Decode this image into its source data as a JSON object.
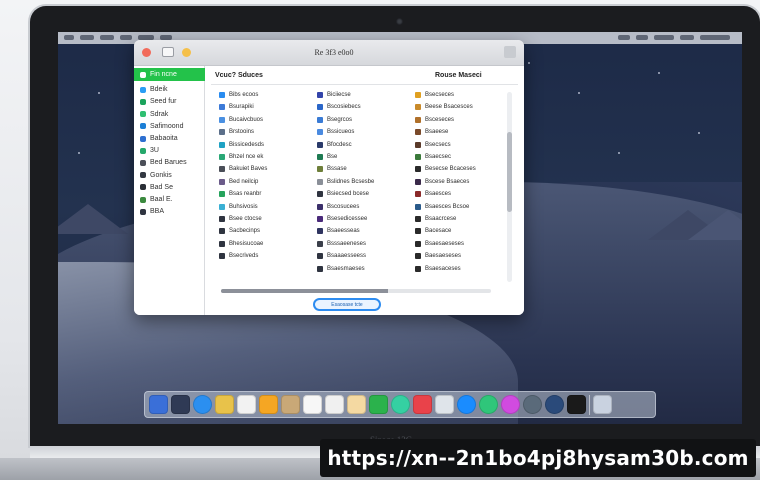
{
  "window": {
    "title": "Re 3f3 e0o0"
  },
  "sidebar": {
    "items": [
      {
        "label": "Fin ncne",
        "color": "#ffffff",
        "selected": true
      },
      {
        "label": "Bdeik",
        "color": "#2a9df4"
      },
      {
        "label": "Seed fur",
        "color": "#1aa35c"
      },
      {
        "label": "Sdrak",
        "color": "#2fbf71"
      },
      {
        "label": "Safimoond",
        "color": "#1c7fd6"
      },
      {
        "label": "Babaoita",
        "color": "#2e6fd0"
      },
      {
        "label": "3U",
        "color": "#25a86b"
      },
      {
        "label": "Bed Barues",
        "color": "#4b4f58"
      },
      {
        "label": "Gonkis",
        "color": "#333842"
      },
      {
        "label": "Bad Se",
        "color": "#2a2e36"
      },
      {
        "label": "Baal E.",
        "color": "#3c8a3f"
      },
      {
        "label": "BBA",
        "color": "#2f3440"
      }
    ]
  },
  "content": {
    "header_left": "Vcuc? Sduces",
    "header_right": "Rouse Maseci",
    "columns": [
      {
        "items": [
          {
            "label": "Bibs ecoos",
            "color": "#2a8cf0"
          },
          {
            "label": "Bsurapiki",
            "color": "#3c7ad8"
          },
          {
            "label": "Bucaivcbuos",
            "color": "#4a90e2"
          },
          {
            "label": "Brstooins",
            "color": "#5b6f8a"
          },
          {
            "label": "Bissicedesds",
            "color": "#1fa2c4"
          },
          {
            "label": "Bhzel nce ek",
            "color": "#2aa876"
          },
          {
            "label": "Bakuiet Baves",
            "color": "#4a4e58"
          },
          {
            "label": "Bed neilcip",
            "color": "#6b5b8a"
          },
          {
            "label": "Bsas reanbr",
            "color": "#25a35c"
          },
          {
            "label": "Buhsivosis",
            "color": "#3ab0d4"
          },
          {
            "label": "Bsee ctocse",
            "color": "#2f3440"
          },
          {
            "label": "Sacbecinps",
            "color": "#2f3440"
          },
          {
            "label": "Bhesisucoae",
            "color": "#2f3440"
          },
          {
            "label": "Bsecriveds",
            "color": "#2f3440"
          }
        ]
      },
      {
        "items": [
          {
            "label": "Biciiecse",
            "color": "#3344aa"
          },
          {
            "label": "Bscosiebecs",
            "color": "#2a66c8"
          },
          {
            "label": "Bsegrcos",
            "color": "#3a7bd5"
          },
          {
            "label": "Bssicueos",
            "color": "#4a8ae0"
          },
          {
            "label": "Bfocdesc",
            "color": "#2a3a6a"
          },
          {
            "label": "Bse",
            "color": "#1e7a52"
          },
          {
            "label": "Bssase",
            "color": "#6e7f3a"
          },
          {
            "label": "Bslidnes Bcsesbe",
            "color": "#8a8f98"
          },
          {
            "label": "Bsiecsed bcese",
            "color": "#2f3440"
          },
          {
            "label": "Bscosucees",
            "color": "#3b2f6a"
          },
          {
            "label": "Bsesedicessee",
            "color": "#4a2a7a"
          },
          {
            "label": "Bsaeesseas",
            "color": "#2f3460"
          },
          {
            "label": "Bsssaeeneses",
            "color": "#3a3f4a"
          },
          {
            "label": "Bsaaaesseess",
            "color": "#2f3440"
          },
          {
            "label": "Bsaesmaeses",
            "color": "#2f3440"
          }
        ]
      },
      {
        "items": [
          {
            "label": "Bsecseces",
            "color": "#e0a020"
          },
          {
            "label": "Beese Bsacesces",
            "color": "#c98a2a"
          },
          {
            "label": "Bsceseces",
            "color": "#b0702a"
          },
          {
            "label": "Bsaeese",
            "color": "#7a4a2a"
          },
          {
            "label": "Bsecsecs",
            "color": "#5a3a2a"
          },
          {
            "label": "Bsaecsec",
            "color": "#3a7a3a"
          },
          {
            "label": "Besecse Bcaceses",
            "color": "#2a2a2a"
          },
          {
            "label": "Bscese Bsaeces",
            "color": "#3a2a4a"
          },
          {
            "label": "Bsaesces",
            "color": "#8a2a2a"
          },
          {
            "label": "Bsaesces Bcsoe",
            "color": "#2a5a8a"
          },
          {
            "label": "Bsaacrcese",
            "color": "#2a2a2a"
          },
          {
            "label": "Bacesace",
            "color": "#2a2a2a"
          },
          {
            "label": "Bsaesaeseses",
            "color": "#2a2a2a"
          },
          {
            "label": "Baesaeseses",
            "color": "#2a2a2a"
          },
          {
            "label": "Bsaesaceses",
            "color": "#2a2a2a"
          }
        ]
      }
    ],
    "progress": 0.62,
    "action_label": "Esaosase tcte"
  },
  "dock": {
    "apps": [
      {
        "name": "finder-icon",
        "color": "#3a6fd8"
      },
      {
        "name": "launchpad-icon",
        "color": "#2f3a55"
      },
      {
        "name": "safari-icon",
        "color": "#2b8ff0"
      },
      {
        "name": "notes-icon",
        "color": "#e8c24a"
      },
      {
        "name": "photos-icon",
        "color": "#f2f2f2"
      },
      {
        "name": "pages-icon",
        "color": "#f5a623"
      },
      {
        "name": "contacts-icon",
        "color": "#c9a877"
      },
      {
        "name": "calendar-icon",
        "color": "#f7f7f7"
      },
      {
        "name": "reminders-icon",
        "color": "#f0f0f0"
      },
      {
        "name": "maps-icon",
        "color": "#f4d9a2"
      },
      {
        "name": "numbers-icon",
        "color": "#2bb24c"
      },
      {
        "name": "facetime-icon",
        "color": "#35d0a2"
      },
      {
        "name": "news-icon",
        "color": "#e9424a"
      },
      {
        "name": "preview-icon",
        "color": "#dfe4ea"
      },
      {
        "name": "appstore-icon",
        "color": "#1a8cff"
      },
      {
        "name": "messages-icon",
        "color": "#2fc67a"
      },
      {
        "name": "itunes-icon",
        "color": "#d14be0"
      },
      {
        "name": "settings-icon",
        "color": "#5a6a7a"
      },
      {
        "name": "quicktime-icon",
        "color": "#2a4a7a"
      },
      {
        "name": "terminal-icon",
        "color": "#1a1a1a"
      },
      {
        "name": "trash-icon",
        "color": "#c9d2e0"
      }
    ]
  },
  "laptop": {
    "model_label": "Sinage 13C"
  },
  "watermark": {
    "url": "https://xn--2n1bo4pj8hysam30b.com"
  }
}
